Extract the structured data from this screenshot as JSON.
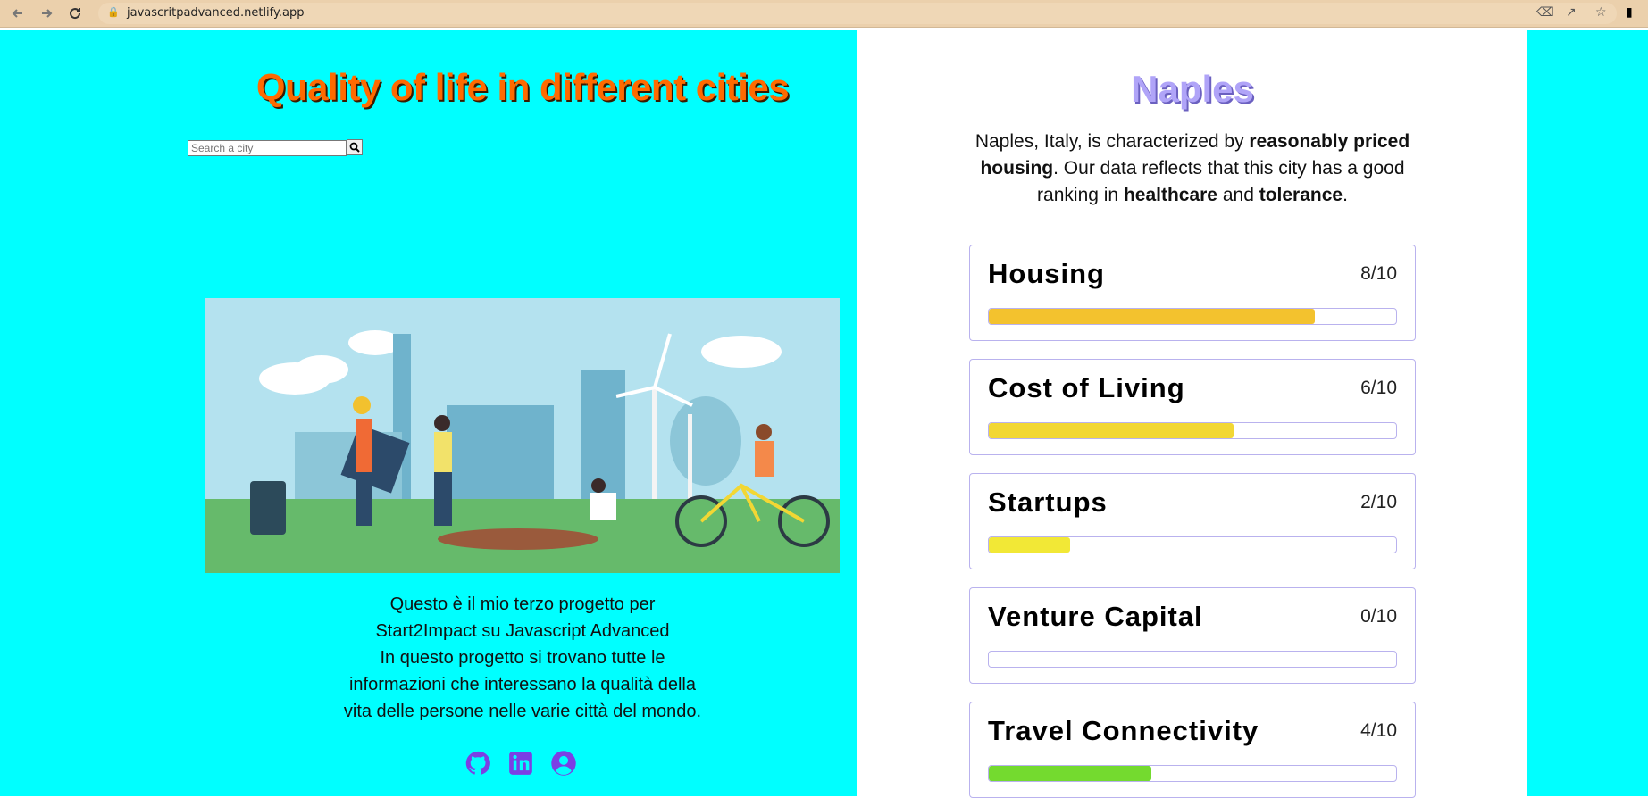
{
  "browser": {
    "url": "javascritpadvanced.netlify.app"
  },
  "page": {
    "title": "Quality of life in different cities",
    "search": {
      "placeholder": "Search a city",
      "value": ""
    },
    "description": [
      "Questo è il mio terzo progetto per",
      "Start2Impact su Javascript Advanced",
      "In questo progetto si trovano tutte le",
      "informazioni che interessano la qualità della",
      "vita delle persone nelle varie città del mondo."
    ],
    "socials": [
      "github-icon",
      "linkedin-icon",
      "user-circle-icon"
    ]
  },
  "city": {
    "name": "Naples",
    "summary": {
      "p1": "Naples, Italy, is characterized by ",
      "b1": "reasonably priced housing",
      "p2": ". Our data reflects that this city has a good ranking in ",
      "b2": "healthcare",
      "p3": " and ",
      "b3": "tolerance",
      "p4": "."
    },
    "categories": [
      {
        "name": "Housing",
        "score_text": "8/10",
        "score": 0.8,
        "color": "#f3c22e"
      },
      {
        "name": "Cost of Living",
        "score_text": "6/10",
        "score": 0.6,
        "color": "#f2d734"
      },
      {
        "name": "Startups",
        "score_text": "2/10",
        "score": 0.2,
        "color": "#f2e836"
      },
      {
        "name": "Venture Capital",
        "score_text": "0/10",
        "score": 0.0,
        "color": "#e0e04a"
      },
      {
        "name": "Travel Connectivity",
        "score_text": "4/10",
        "score": 0.4,
        "color": "#74da2f"
      }
    ]
  },
  "colors": {
    "accent_cyan": "#00ffff",
    "title_orange": "#ff6a00",
    "city_lavender": "#b0a4f8",
    "social_purple": "#7b3fe4"
  }
}
